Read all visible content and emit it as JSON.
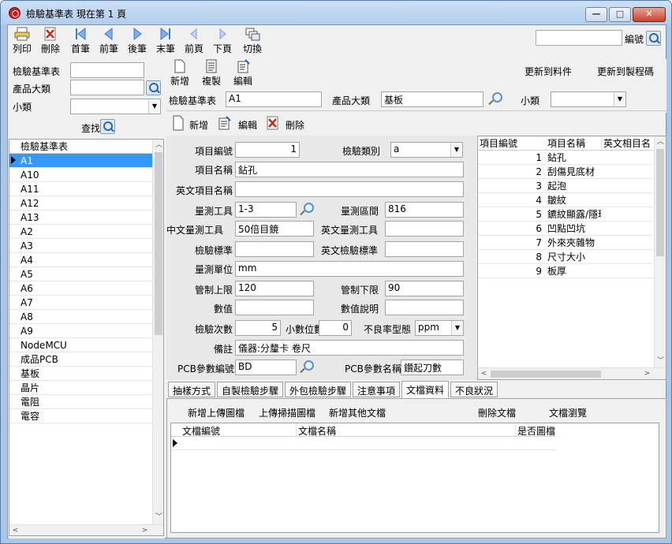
{
  "window": {
    "title": "檢驗基準表  現在第 1 頁",
    "min_glyph": "—",
    "max_glyph": "□",
    "close_glyph": "✕"
  },
  "toolbar": {
    "items": [
      {
        "name": "print",
        "label": "列印",
        "icon": "printer-icon"
      },
      {
        "name": "delete",
        "label": "刪除",
        "icon": "delete-icon"
      },
      {
        "name": "first",
        "label": "首筆",
        "icon": "first-record-icon"
      },
      {
        "name": "prev",
        "label": "前筆",
        "icon": "prev-record-icon"
      },
      {
        "name": "next",
        "label": "後筆",
        "icon": "next-record-icon"
      },
      {
        "name": "last",
        "label": "末筆",
        "icon": "last-record-icon"
      },
      {
        "name": "prev-page",
        "label": "前頁",
        "icon": "prev-page-icon"
      },
      {
        "name": "next-page",
        "label": "下頁",
        "icon": "next-page-icon"
      },
      {
        "name": "switch",
        "label": "切換",
        "icon": "switch-icon"
      }
    ],
    "edit_label": "編號"
  },
  "filter": {
    "standard_label": "檢驗基準表",
    "category_label": "產品大類",
    "subcategory_label": "小類",
    "find_label": "查找"
  },
  "list": {
    "header": "檢驗基準表",
    "items": [
      "A1",
      "A10",
      "A11",
      "A12",
      "A13",
      "A2",
      "A3",
      "A4",
      "A5",
      "A6",
      "A7",
      "A8",
      "A9",
      "NodeMCU",
      "成品PCB",
      "基板",
      "晶片",
      "電阻",
      "電容"
    ],
    "selected_index": 0
  },
  "header_actions": {
    "new_label": "新增",
    "copy_label": "複製",
    "edit_label": "編輯",
    "update_material_label": "更新到料件",
    "update_process_label": "更新到製程碼"
  },
  "master": {
    "standard_label": "檢驗基準表",
    "standard_value": "A1",
    "category_label": "產品大類",
    "category_value": "基板",
    "subcategory_label": "小類",
    "subcategory_value": ""
  },
  "detail_actions": {
    "new_label": "新增",
    "edit_label": "編輯",
    "delete_label": "刪除"
  },
  "form": {
    "item_no_label": "項目編號",
    "item_no_value": "1",
    "check_type_label": "檢驗類別",
    "check_type_value": "a",
    "item_name_label": "項目名稱",
    "item_name_value": "鉆孔",
    "en_item_name_label": "英文項目名稱",
    "en_item_name_value": "",
    "tool_label": "量測工具",
    "tool_value": "1-3",
    "range_label": "量測區間",
    "range_value": "816",
    "cn_tool_label": "中文量測工具",
    "cn_tool_value": "50倍目鏡",
    "en_tool_label": "英文量測工具",
    "en_tool_value": "",
    "standard_label": "檢驗標準",
    "standard_value": "",
    "en_standard_label": "英文檢驗標準",
    "en_standard_value": "",
    "unit_label": "量測單位",
    "unit_value": "mm",
    "upper_label": "管制上限",
    "upper_value": "120",
    "lower_label": "管制下限",
    "lower_value": "90",
    "numeric_label": "數值",
    "numeric_value": "",
    "numeric_desc_label": "數值說明",
    "numeric_desc_value": "",
    "count_label": "檢驗次數",
    "count_value": "5",
    "decimal_label": "小數位數",
    "decimal_value": "0",
    "defect_label": "不良率型態",
    "defect_value": "ppm",
    "note_label": "備註",
    "note_value": "儀器:分釐卡 卷尺",
    "pcb_no_label": "PCB參數編號",
    "pcb_no_value": "BD",
    "pcb_name_label": "PCB參數名稱",
    "pcb_name_value": "鑽起刀數"
  },
  "item_grid": {
    "columns": [
      "項目編號",
      "項目名稱",
      "英文相目名"
    ],
    "rows": [
      {
        "no": "1",
        "name": "鉆孔"
      },
      {
        "no": "2",
        "name": "刮傷見底材"
      },
      {
        "no": "3",
        "name": "起泡"
      },
      {
        "no": "4",
        "name": "皺紋"
      },
      {
        "no": "5",
        "name": "鑣紋顯露/隱現"
      },
      {
        "no": "6",
        "name": "凹點凹坑"
      },
      {
        "no": "7",
        "name": "外來夾雜物"
      },
      {
        "no": "8",
        "name": "尺寸大小"
      },
      {
        "no": "9",
        "name": "板厚"
      }
    ]
  },
  "tabs": [
    "抽樣方式",
    "自製檢驗步驟",
    "外包檢驗步驟",
    "注意事項",
    "文檔資料",
    "不良狀況"
  ],
  "active_tab": 4,
  "doc_actions": {
    "add_image_label": "新增上傳圖檔",
    "add_scan_label": "上傳掃描圖檔",
    "add_other_label": "新增其他文檔",
    "delete_label": "刪除文檔",
    "browse_label": "文檔瀏覽"
  },
  "doc_grid": {
    "columns": [
      "文檔編號",
      "文檔名稱",
      "是否圖檔"
    ]
  },
  "scroll_glyphs": {
    "up": "︿",
    "down": "﹀",
    "left": "<",
    "right": ">"
  }
}
